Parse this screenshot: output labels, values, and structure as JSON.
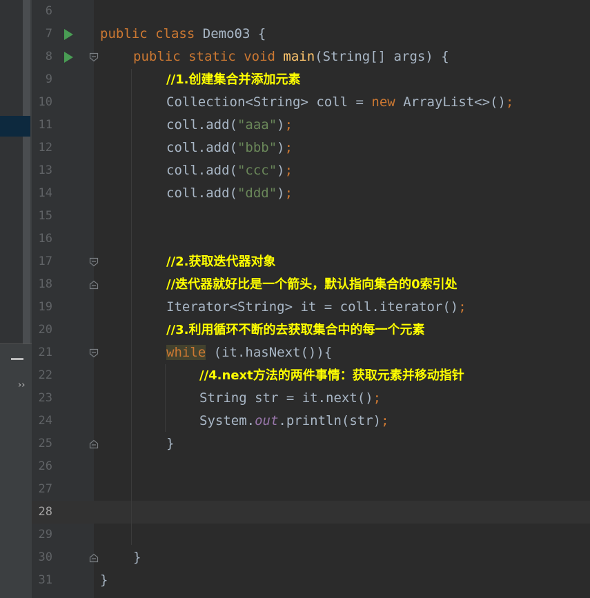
{
  "sidebar": {
    "collapse_icon": "minus-icon",
    "expand_icon": "chevrons-icon",
    "expand_glyph": "››"
  },
  "editor": {
    "current_line": 28,
    "colors": {
      "keyword": "#cc7832",
      "method": "#ffc66d",
      "string": "#6a8759",
      "field": "#9876aa",
      "comment": "#ffff00",
      "plain": "#a9b7c6",
      "line_number": "#606366",
      "run_icon": "#499c54"
    },
    "lines": [
      {
        "n": "6",
        "text": ""
      },
      {
        "n": "7",
        "text": "public class Demo03 {",
        "run": true
      },
      {
        "n": "8",
        "text": "public static void main(String[] args) {",
        "run": true,
        "fold": "open"
      },
      {
        "n": "9",
        "text": "//1.创建集合并添加元素"
      },
      {
        "n": "10",
        "text": "Collection<String> coll = new ArrayList<>();"
      },
      {
        "n": "11",
        "text": "coll.add(\"aaa\");"
      },
      {
        "n": "12",
        "text": "coll.add(\"bbb\");"
      },
      {
        "n": "13",
        "text": "coll.add(\"ccc\");"
      },
      {
        "n": "14",
        "text": "coll.add(\"ddd\");"
      },
      {
        "n": "15",
        "text": ""
      },
      {
        "n": "16",
        "text": ""
      },
      {
        "n": "17",
        "text": "//2.获取迭代器对象",
        "fold": "open"
      },
      {
        "n": "18",
        "text": "//迭代器就好比是一个箭头，默认指向集合的0索引处",
        "fold": "close"
      },
      {
        "n": "19",
        "text": "Iterator<String> it = coll.iterator();"
      },
      {
        "n": "20",
        "text": "//3.利用循环不断的去获取集合中的每一个元素"
      },
      {
        "n": "21",
        "text": "while (it.hasNext()){",
        "fold": "open"
      },
      {
        "n": "22",
        "text": "//4.next方法的两件事情：获取元素并移动指针"
      },
      {
        "n": "23",
        "text": "String str = it.next();"
      },
      {
        "n": "24",
        "text": "System.out.println(str);"
      },
      {
        "n": "25",
        "text": "}",
        "fold": "close"
      },
      {
        "n": "26",
        "text": ""
      },
      {
        "n": "27",
        "text": ""
      },
      {
        "n": "28",
        "text": ""
      },
      {
        "n": "29",
        "text": ""
      },
      {
        "n": "30",
        "text": "}",
        "fold": "close"
      },
      {
        "n": "31",
        "text": "}"
      }
    ],
    "tokens": {
      "l7": [
        "public",
        "class",
        "Demo03 {"
      ],
      "l8": [
        "public",
        "static",
        "void",
        "main",
        "(String[] args) {"
      ],
      "l9": "//1.创建集合并添加元素",
      "l10": [
        "Collection<String> coll = ",
        "new",
        " ArrayList<>()",
        ";"
      ],
      "l11": [
        "coll.add(",
        "\"aaa\"",
        ")",
        ";"
      ],
      "l12": [
        "coll.add(",
        "\"bbb\"",
        ")",
        ";"
      ],
      "l13": [
        "coll.add(",
        "\"ccc\"",
        ")",
        ";"
      ],
      "l14": [
        "coll.add(",
        "\"ddd\"",
        ")",
        ";"
      ],
      "l17": "//2.获取迭代器对象",
      "l18": "//迭代器就好比是一个箭头，默认指向集合的0索引处",
      "l19": [
        "Iterator<String> it = coll.iterator()",
        ";"
      ],
      "l20": "//3.利用循环不断的去获取集合中的每一个元素",
      "l21": [
        "while",
        " (it.hasNext()){"
      ],
      "l22": "//4.next方法的两件事情：获取元素并移动指针",
      "l23": [
        "String str = it.next()",
        ";"
      ],
      "l24": [
        "System.",
        "out",
        ".println(str)",
        ";"
      ],
      "l25": "}",
      "l30": "}",
      "l31": "}"
    }
  }
}
